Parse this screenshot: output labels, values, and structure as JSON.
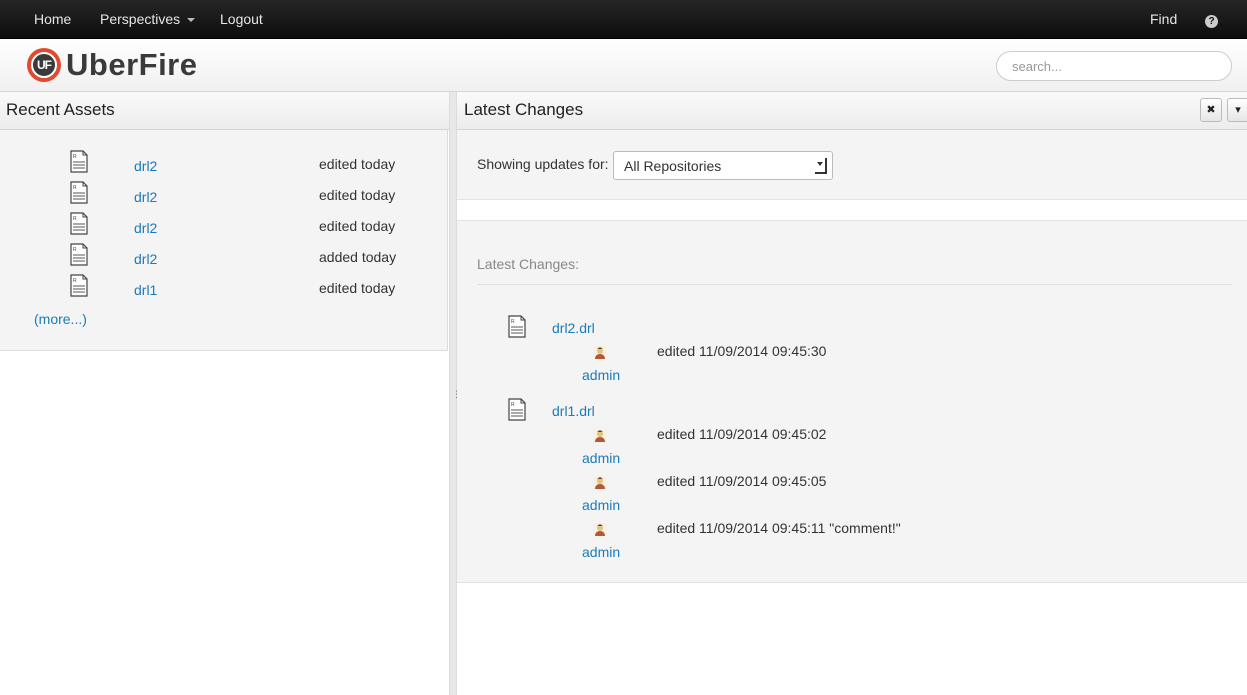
{
  "navbar": {
    "home": "Home",
    "perspectives": "Perspectives",
    "logout": "Logout",
    "find": "Find",
    "help": "?"
  },
  "brand": {
    "logo_initials": "UF",
    "name": "UberFire",
    "logo_color": "#e04a2f"
  },
  "search": {
    "placeholder": "search..."
  },
  "recent_assets": {
    "title": "Recent Assets",
    "items": [
      {
        "name": "drl2",
        "status": "edited today"
      },
      {
        "name": "drl2",
        "status": "edited today"
      },
      {
        "name": "drl2",
        "status": "edited today"
      },
      {
        "name": "drl2",
        "status": "added today"
      },
      {
        "name": "drl1",
        "status": "edited today"
      }
    ],
    "more": "(more...)"
  },
  "latest_changes": {
    "title": "Latest Changes",
    "close_icon": "✖",
    "menu_icon": "▾",
    "filter_label": "Showing updates for:",
    "filter_value": "All Repositories",
    "heading": "Latest Changes:",
    "files": [
      {
        "name": "drl2.drl",
        "changes": [
          {
            "text": "edited 11/09/2014 09:45:30",
            "user": "admin"
          }
        ]
      },
      {
        "name": "drl1.drl",
        "changes": [
          {
            "text": "edited 11/09/2014 09:45:02",
            "user": "admin"
          },
          {
            "text": "edited 11/09/2014 09:45:05",
            "user": "admin"
          },
          {
            "text": "edited 11/09/2014 09:45:11 \"comment!\"",
            "user": "admin"
          }
        ]
      }
    ]
  },
  "colors": {
    "link": "#1a7bb9",
    "navbar": "#1a1a1a"
  }
}
